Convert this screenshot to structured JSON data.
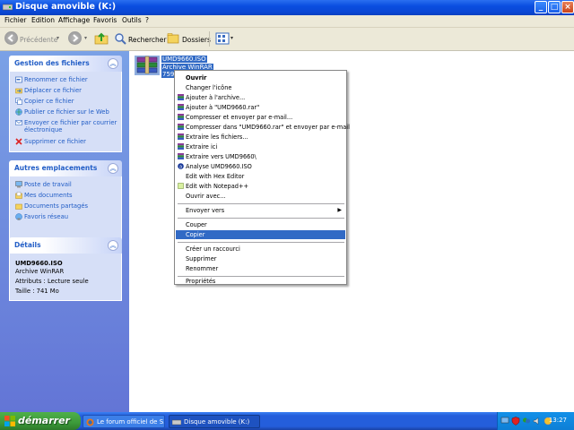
{
  "window": {
    "title": "Disque amovible (K:)"
  },
  "menubar": {
    "items": [
      "Fichier",
      "Edition",
      "Affichage",
      "Favoris",
      "Outils",
      "?"
    ]
  },
  "toolbar": {
    "back_label": "Précédente",
    "search_label": "Rechercher",
    "folders_label": "Dossiers"
  },
  "sidebar": {
    "file_tasks": {
      "title": "Gestion des fichiers",
      "items": [
        "Renommer ce fichier",
        "Déplacer ce fichier",
        "Copier ce fichier",
        "Publier ce fichier sur le Web",
        "Envoyer ce fichier par courrier électronique",
        "Supprimer ce fichier"
      ]
    },
    "other_places": {
      "title": "Autres emplacements",
      "items": [
        "Poste de travail",
        "Mes documents",
        "Documents partagés",
        "Favoris réseau"
      ]
    },
    "details": {
      "title": "Détails",
      "name": "UMD9660.ISO",
      "type": "Archive WinRAR",
      "attributes": "Attributs : Lecture seule",
      "size": "Taille : 741 Mo"
    }
  },
  "file": {
    "name": "UMD9660.ISO",
    "type": "Archive WinRAR",
    "size_partial": "759"
  },
  "context_menu": {
    "items": [
      "Ouvrir",
      "Changer l'icône",
      "Ajouter à l'archive...",
      "Ajouter à \"UMD9660.rar\"",
      "Compresser et envoyer par e-mail...",
      "Compresser dans \"UMD9660.rar\" et envoyer par e-mail",
      "Extraire les fichiers...",
      "Extraire ici",
      "Extraire vers UMD9660\\",
      "Analyse UMD9660.ISO",
      "Edit with Hex Editor",
      "Edit with Notepad++",
      "Ouvrir avec...",
      "Envoyer vers",
      "Couper",
      "Copier",
      "Créer un raccourci",
      "Supprimer",
      "Renommer",
      "Propriétés"
    ],
    "selected": "Copier"
  },
  "taskbar": {
    "start_label": "démarrer",
    "tasks": [
      "Le forum officiel de S...",
      "Disque amovible (K:)"
    ],
    "clock": "13:27"
  },
  "colors": {
    "selection": "#316ac5",
    "panel_link": "#215dc6",
    "titlebar": "#0a4ee0"
  }
}
